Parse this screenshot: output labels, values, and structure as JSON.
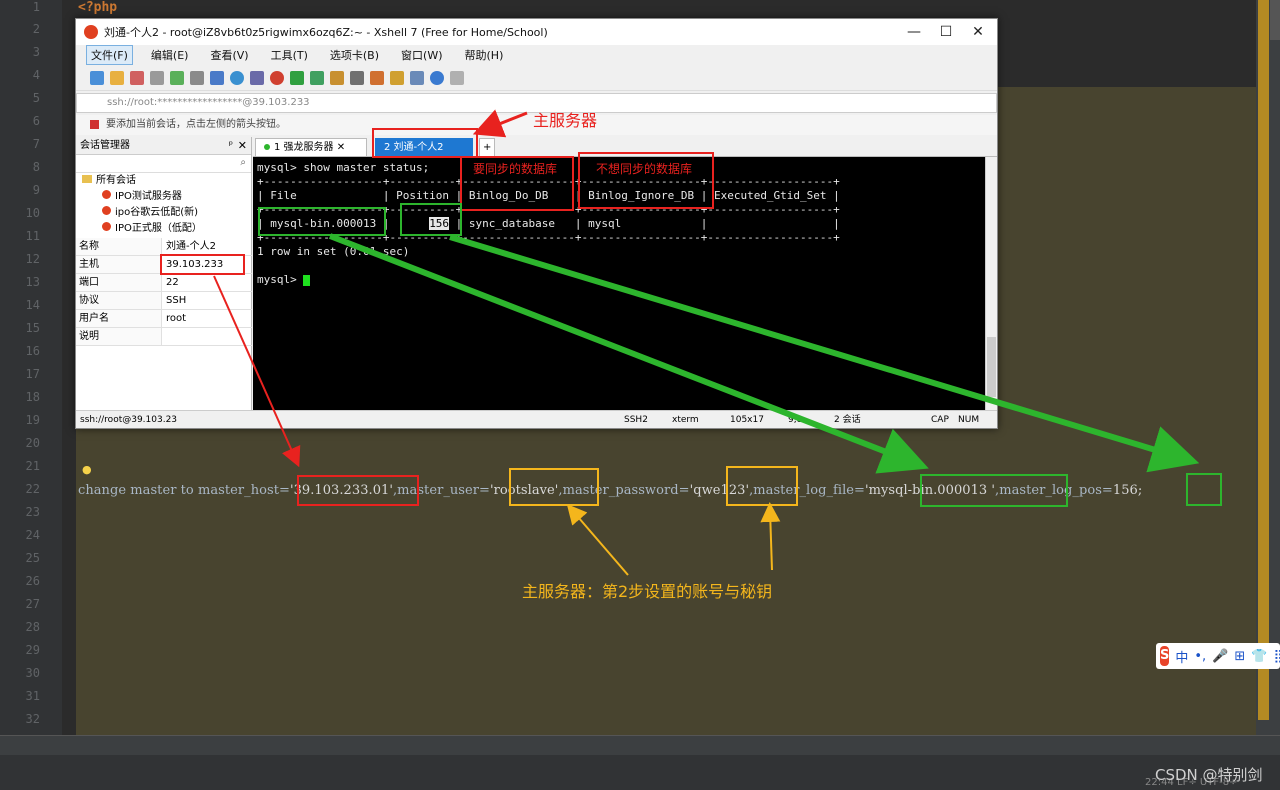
{
  "ide": {
    "line_numbers": [
      "1",
      "2",
      "3",
      "4",
      "5",
      "6",
      "7",
      "8",
      "9",
      "10",
      "11",
      "12",
      "13",
      "14",
      "15",
      "16",
      "17",
      "18",
      "19",
      "20",
      "21",
      "22",
      "23",
      "24",
      "25",
      "26",
      "27",
      "28",
      "29",
      "30",
      "31",
      "32"
    ],
    "php_tag": "<?php",
    "code_line": {
      "p1": "change master to master_host=",
      "host": "'39.103.233.01'",
      "p2": ",master_user=",
      "user": "'rootslave'",
      "p3": ",master_password=",
      "password": "'qwe123'",
      "p4": ",master_log_file=",
      "log_file": "'mysql-bin.000013 '",
      "p5": ",master_log_pos=",
      "log_pos": "156;"
    },
    "watermark": "CSDN @特别剑",
    "status_time": "22:44",
    "status_lf": "LF÷",
    "status_enc": "UTF-8÷"
  },
  "ime": {
    "logo": "S",
    "items": [
      "中",
      "•,",
      "🎤",
      "⊞",
      "👕",
      "⣿"
    ]
  },
  "xshell": {
    "title": "刘通-个人2 - root@iZ8vb6t0z5rigwimx6ozq6Z:~ - Xshell 7 (Free for Home/School)",
    "window_controls": [
      "—",
      "☐",
      "✕"
    ],
    "menu": [
      "文件(F)",
      "编辑(E)",
      "查看(V)",
      "工具(T)",
      "选项卡(B)",
      "窗口(W)",
      "帮助(H)"
    ],
    "address": "ssh://root:*****************@39.103.233",
    "hint": "要添加当前会话，点击左侧的箭头按钮。",
    "session_manager": {
      "title": "会话管理器",
      "pin": "ᵖ",
      "close": "✕",
      "tree": [
        "所有会话",
        "IPO测试服务器",
        "ipo谷歌云低配(新)",
        "IPO正式服（低配）"
      ],
      "props": [
        {
          "k": "名称",
          "v": "刘通-个人2"
        },
        {
          "k": "主机",
          "v": "39.103.233"
        },
        {
          "k": "端口",
          "v": "22"
        },
        {
          "k": "协议",
          "v": "SSH"
        },
        {
          "k": "用户名",
          "v": "root"
        },
        {
          "k": "说明",
          "v": ""
        }
      ]
    },
    "tabs": [
      "1 强龙服务器",
      "2 刘通-个人2"
    ],
    "tab_add": "+",
    "terminal": {
      "lines": [
        "mysql> show master status;",
        "+------------------+----------+-----------------+------------------+-------------------+",
        "| File             | Position | Binlog_Do_DB    | Binlog_Ignore_DB | Executed_Gtid_Set |",
        "+------------------+----------+-----------------+------------------+-------------------+",
        "| mysql-bin.000013 |      ",
        "+------------------+----------+-----------------+------------------+-------------------+",
        "1 row in set (0.01 sec)",
        "",
        "mysql> "
      ],
      "pos_value": "156",
      "row_tail": " | sync_database   | mysql            |                   |"
    },
    "status": {
      "left": "ssh://root@39.103.23",
      "ssh": "SSH2",
      "term": "xterm",
      "size": "105x17",
      "pos": "9,8",
      "sessions": "2 会话",
      "cap": "CAP",
      "num": "NUM"
    }
  },
  "annotations": {
    "main_server": "主服务器",
    "do_db": "要同步的数据库",
    "ignore_db": "不想同步的数据库",
    "account_note": "主服务器：第2步设置的账号与秘钥"
  },
  "colors": {
    "red": "#e8221f",
    "green": "#2db52d",
    "yellow": "#f4b61c",
    "accent": "#1e78d2"
  }
}
